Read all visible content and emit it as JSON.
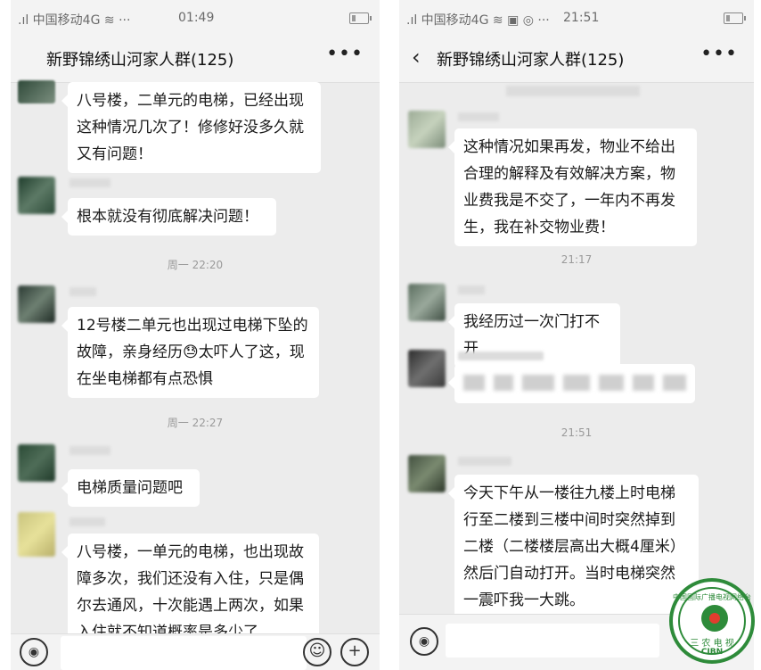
{
  "left": {
    "status": {
      "carrier": ".ıl 中国移动4G ≋ ···",
      "time": "01:49"
    },
    "title": "新野锦绣山河家人群(125)",
    "messages": [
      {
        "text": "八号楼，二单元的电梯，已经出现这种情况几次了！修修好没多久就又有问题！"
      },
      {
        "text": "根本就没有彻底解决问题！"
      },
      {
        "time": "周一 22:20"
      },
      {
        "text": "12号楼二单元也出现过电梯下坠的故障，亲身经历😓太吓人了这，现在坐电梯都有点恐惧"
      },
      {
        "time": "周一 22:27"
      },
      {
        "text": "电梯质量问题吧"
      },
      {
        "text": "八号楼，一单元的电梯，也出现故障多次，我们还没有入住，只是偶尔去通风，十次能遇上两次，如果入住就不知道概率是多少了，"
      }
    ]
  },
  "right": {
    "status": {
      "carrier": ".ıl 中国移动4G ≋ ▣ ◎ ···",
      "time": "21:51"
    },
    "title": "新野锦绣山河家人群(125)",
    "messages": [
      {
        "text": "这种情况如果再发，物业不给出合理的解释及有效解决方案，物业费我是不交了，一年内不再发生，我在补交物业费！"
      },
      {
        "time": "21:17"
      },
      {
        "text": "我经历过一次门打不开"
      },
      {
        "time": "21:51"
      },
      {
        "text": "今天下午从一楼往九楼上时电梯行至二楼到三楼中间时突然掉到二楼（二楼楼层高出大概4厘米）然后门自动打开。当时电梯突然一震吓我一大跳。"
      }
    ]
  },
  "icons": {
    "back": "chevron-left-icon",
    "more": "more-dots-icon",
    "voice": "voice-input-icon",
    "emoji": "emoji-icon",
    "add": "add-icon"
  },
  "logo": {
    "cn": "三 农 电 视",
    "en": "CIBN",
    "arc": "中国国际广播电视网络台"
  },
  "colors": {
    "chat_bg": "#ececec",
    "bubble": "#ffffff",
    "logo_green": "#2e8b3a"
  }
}
